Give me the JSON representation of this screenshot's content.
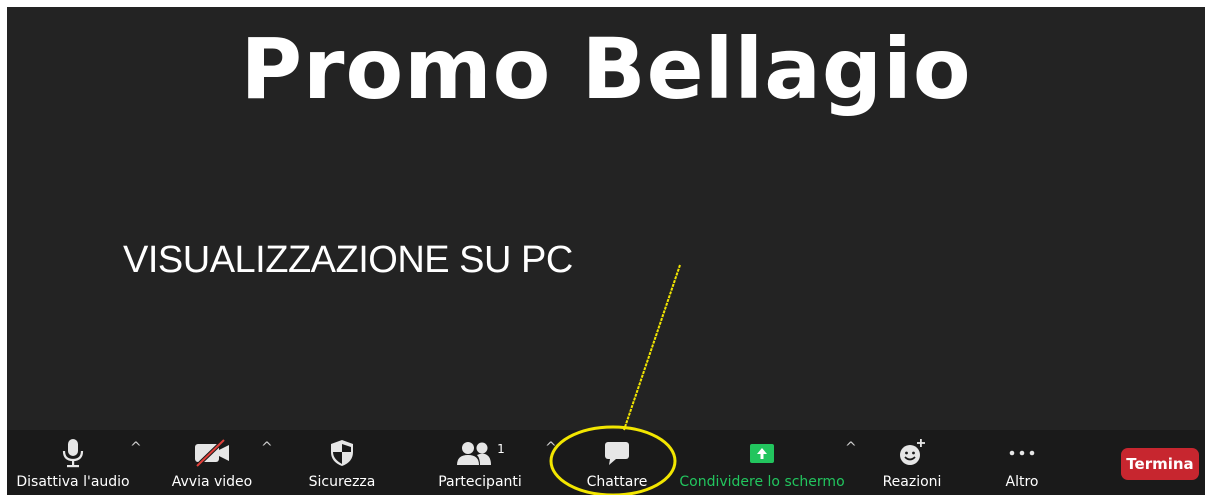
{
  "slide": {
    "title": "Promo Bellagio",
    "subtitle": "VISUALIZZAZIONE SU PC"
  },
  "toolbar": {
    "audio_label": "Disattiva l'audio",
    "video_label": "Avvia video",
    "security_label": "Sicurezza",
    "participants_label": "Partecipanti",
    "participants_count": "1",
    "chat_label": "Chattare",
    "share_label": "Condividere lo schermo",
    "reactions_label": "Reazioni",
    "more_label": "Altro",
    "end_label": "Termina",
    "caret": "^"
  },
  "colors": {
    "background": "#232323",
    "toolbar": "#1a1a1a",
    "share_green": "#22c55e",
    "end_red": "#c7262f",
    "highlight_yellow": "#f2e600"
  }
}
